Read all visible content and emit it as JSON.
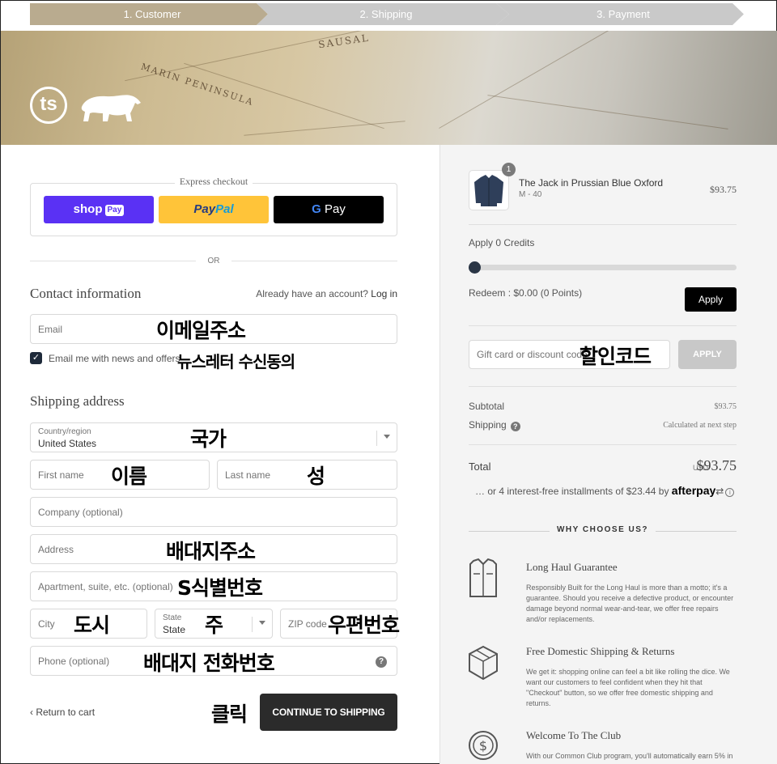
{
  "steps": [
    "1. Customer",
    "2. Shipping",
    "3. Payment"
  ],
  "banner": {
    "logo_text": "ts",
    "map_text_1": "SAUSAL",
    "map_text_2": "MARIN PENINSULA"
  },
  "express": {
    "title": "Express checkout",
    "shop_pay": "shop",
    "shop_pay_pill": "Pay",
    "paypal_a": "Pay",
    "paypal_b": "Pal",
    "gpay_g": "G",
    "gpay": "Pay"
  },
  "or_text": "OR",
  "contact": {
    "heading": "Contact information",
    "login_hint": "Already have an account?",
    "login_link": "Log in",
    "email_placeholder": "Email",
    "newsletter_label": "Email me with news and offers"
  },
  "shipping": {
    "heading": "Shipping address",
    "country_label": "Country/region",
    "country_value": "United States",
    "first_name": "First name",
    "last_name": "Last name",
    "company": "Company (optional)",
    "address": "Address",
    "apartment": "Apartment, suite, etc. (optional)",
    "city": "City",
    "state_label": "State",
    "state_value": "State",
    "zip": "ZIP code",
    "phone": "Phone (optional)"
  },
  "annotations": {
    "email": "이메일주소",
    "newsletter": "뉴스레터 수신동의",
    "country": "국가",
    "first_name": "이름",
    "last_name": "성",
    "address": "배대지주소",
    "apartment": "S식별번호",
    "city": "도시",
    "state": "주",
    "zip": "우편번호",
    "phone": "배대지 전화번호",
    "continue": "클릭",
    "discount": "할인코드"
  },
  "nav": {
    "back": "Return to cart",
    "continue": "CONTINUE TO SHIPPING"
  },
  "order": {
    "quantity": "1",
    "product_name": "The Jack in Prussian Blue Oxford",
    "product_variant": "M - 40",
    "product_price": "$93.75",
    "credits_label": "Apply 0 Credits",
    "credits_fraction": 0,
    "redeem": "Redeem : $0.00 (0 Points)",
    "apply_dark": "Apply",
    "discount_placeholder": "Gift card or discount code",
    "apply_grey": "APPLY",
    "subtotal_label": "Subtotal",
    "subtotal_value": "$93.75",
    "shipping_label": "Shipping",
    "shipping_value": "Calculated at next step",
    "total_label": "Total",
    "total_currency": "USD",
    "total_value": "$93.75",
    "afterpay_text": "… or 4 interest-free installments of $23.44 by",
    "afterpay_brand": "afterpay",
    "why_title": "WHY CHOOSE US?"
  },
  "features": [
    {
      "title": "Long Haul Guarantee",
      "body": "Responsibly Built for the Long Haul is more than a motto; it's a guarantee. Should you receive a defective product, or encounter damage beyond normal wear-and-tear, we offer free repairs and/or replacements."
    },
    {
      "title": "Free Domestic Shipping & Returns",
      "body": "We get it: shopping online can feel a bit like rolling the dice. We want our customers to feel confident when they hit that \"Checkout\" button, so we offer free domestic shipping and returns."
    },
    {
      "title": "Welcome To The Club",
      "body": "With our Common Club program, you'll automatically earn 5% in"
    }
  ],
  "colors": {
    "step_active": "#b9ab8f",
    "step_inactive": "#c9c9c9",
    "shop_pay": "#5a31f4",
    "paypal": "#ffc439",
    "dark_button": "#2b2b2b"
  }
}
